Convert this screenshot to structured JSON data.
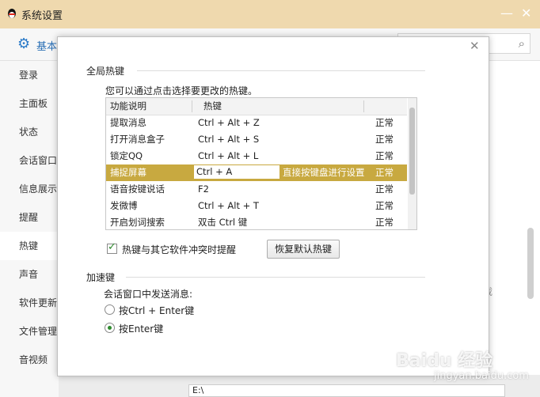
{
  "window": {
    "title": "系统设置",
    "min_glyph": "—",
    "close_glyph": "✕"
  },
  "tabbar": {
    "tab_label": "基本"
  },
  "sidebar": {
    "items": [
      {
        "label": "登录"
      },
      {
        "label": "主面板"
      },
      {
        "label": "状态"
      },
      {
        "label": "会话窗口"
      },
      {
        "label": "信息展示"
      },
      {
        "label": "提醒"
      },
      {
        "label": "热键"
      },
      {
        "label": "声音"
      },
      {
        "label": "软件更新"
      },
      {
        "label": "文件管理"
      },
      {
        "label": "音视频"
      }
    ],
    "active_index": 6
  },
  "background": {
    "partial_text": "载",
    "path_value": "E:\\"
  },
  "dialog": {
    "close_glyph": "✕",
    "global_hotkeys": {
      "section_title": "全局热键",
      "hint": "您可以通过点击选择要更改的热键。",
      "columns": [
        "功能说明",
        "热键"
      ],
      "rows": [
        {
          "desc": "提取消息",
          "key": "Ctrl + Alt + Z",
          "status": "正常"
        },
        {
          "desc": "打开消息盒子",
          "key": "Ctrl + Alt + S",
          "status": "正常"
        },
        {
          "desc": "锁定QQ",
          "key": "Ctrl + Alt + L",
          "status": "正常"
        },
        {
          "desc": "捕捉屏幕",
          "key": "Ctrl + A",
          "edit_hint": "直接按键盘进行设置",
          "status": "正常",
          "selected": true
        },
        {
          "desc": "语音按键说话",
          "key": "F2",
          "status": "正常"
        },
        {
          "desc": "发微博",
          "key": "Ctrl + Alt + T",
          "status": "正常"
        },
        {
          "desc": "开启划词搜索",
          "key": "双击 Ctrl 键",
          "status": "正常"
        }
      ],
      "conflict_checkbox": {
        "label": "热键与其它软件冲突时提醒",
        "checked": true
      },
      "restore_button": "恢复默认热键"
    },
    "accelerators": {
      "section_title": "加速键",
      "hint": "会话窗口中发送消息:",
      "options": [
        {
          "label": "按Ctrl + Enter键",
          "selected": false
        },
        {
          "label": "按Enter键",
          "selected": true
        }
      ]
    }
  },
  "colors": {
    "title_bar": "#efd9ae",
    "selected_row": "#c8a940",
    "accent_blue": "#2a7ac8",
    "check_green": "#2e8b2e"
  },
  "watermark": {
    "text": "Baidu 经验",
    "url": "jingyan.baidu.com"
  }
}
